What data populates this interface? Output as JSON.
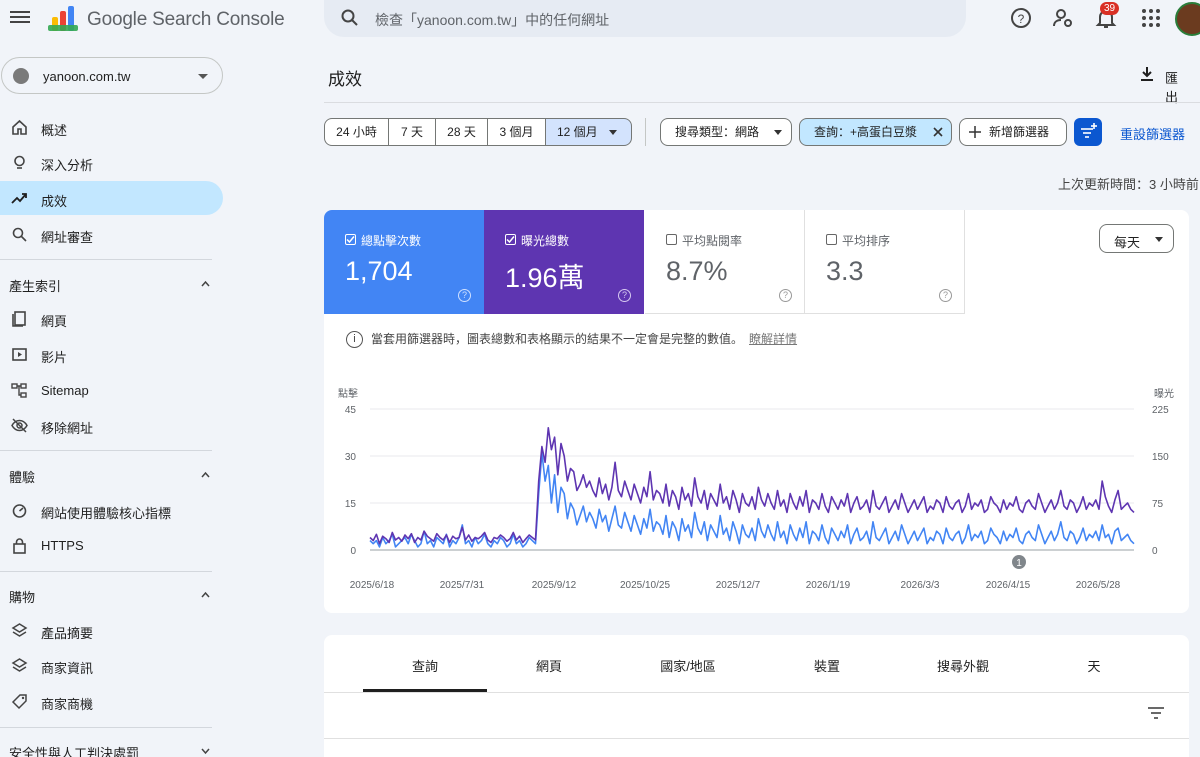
{
  "app": {
    "name": "Google Search Console"
  },
  "search": {
    "placeholder": "檢查「yanoon.com.tw」中的任何網址"
  },
  "notifications": {
    "count": "39"
  },
  "property": {
    "name": "yanoon.com.tw"
  },
  "sidebar": {
    "items": [
      {
        "label": "概述",
        "icon": "home-icon"
      },
      {
        "label": "深入分析",
        "icon": "lightbulb-icon"
      },
      {
        "label": "成效",
        "icon": "trending-up-icon"
      },
      {
        "label": "網址審查",
        "icon": "search-icon"
      }
    ],
    "sections": [
      {
        "title": "產生索引",
        "items": [
          {
            "label": "網頁",
            "icon": "pages-icon"
          },
          {
            "label": "影片",
            "icon": "video-icon"
          },
          {
            "label": "Sitemap",
            "icon": "sitemap-icon"
          },
          {
            "label": "移除網址",
            "icon": "eye-off-icon"
          }
        ]
      },
      {
        "title": "體驗",
        "items": [
          {
            "label": "網站使用體驗核心指標",
            "icon": "gauge-icon"
          },
          {
            "label": "HTTPS",
            "icon": "lock-icon"
          }
        ]
      },
      {
        "title": "購物",
        "items": [
          {
            "label": "產品摘要",
            "icon": "layers-icon"
          },
          {
            "label": "商家資訊",
            "icon": "layers-icon"
          },
          {
            "label": "商家商機",
            "icon": "tag-icon"
          }
        ]
      },
      {
        "title": "安全性與人工判決處罰"
      }
    ]
  },
  "page": {
    "title": "成效",
    "export_label": "匯出",
    "updated": "上次更新時間：3 小時前"
  },
  "filters": {
    "ranges": [
      "24 小時",
      "7 天",
      "28 天",
      "3 個月",
      "12 個月"
    ],
    "search_type": "搜尋類型：網路",
    "query": "查詢：+高蛋白豆漿",
    "add_filter": "新增篩選器",
    "reset": "重設篩選器"
  },
  "metrics": [
    {
      "label": "總點擊次數",
      "value": "1,704",
      "checked": true,
      "color": "#4285f4"
    },
    {
      "label": "曝光總數",
      "value": "1.96萬",
      "checked": true,
      "color": "#5e35b1"
    },
    {
      "label": "平均點閱率",
      "value": "8.7%",
      "checked": false
    },
    {
      "label": "平均排序",
      "value": "3.3",
      "checked": false
    }
  ],
  "granularity": "每天",
  "notice": {
    "text": "當套用篩選器時，圖表總數和表格顯示的結果不一定會是完整的數值。",
    "link": "瞭解詳情"
  },
  "chart_data": {
    "type": "line",
    "left_axis_label": "點擊",
    "right_axis_label": "曝光",
    "left_ticks": [
      "45",
      "30",
      "15",
      "0"
    ],
    "right_ticks": [
      "225",
      "150",
      "75",
      "0"
    ],
    "ylim_left": [
      0,
      45
    ],
    "ylim_right": [
      0,
      225
    ],
    "x_ticks": [
      "2025/6/18",
      "2025/7/31",
      "2025/9/12",
      "2025/10/25",
      "2025/12/7",
      "2026/1/19",
      "2026/3/3",
      "2026/4/15",
      "2026/5/28"
    ],
    "annotation": "1",
    "annotation_at": "2026/4/19",
    "series": [
      {
        "name": "總點擊次數",
        "color": "#4285f4",
        "axis": "left",
        "values": [
          3,
          2,
          3,
          1,
          4,
          2,
          3,
          5,
          1,
          2,
          3,
          4,
          2,
          5,
          3,
          1,
          2,
          6,
          2,
          3,
          1,
          4,
          3,
          2,
          5,
          1,
          3,
          2,
          4,
          8,
          2,
          3,
          1,
          4,
          2,
          3,
          5,
          2,
          1,
          3,
          2,
          4,
          3,
          1,
          2,
          5,
          2,
          3,
          1,
          2,
          4,
          3,
          2,
          18,
          31,
          22,
          27,
          15,
          24,
          12,
          20,
          18,
          10,
          15,
          13,
          8,
          11,
          14,
          9,
          12,
          10,
          7,
          13,
          9,
          11,
          6,
          10,
          14,
          8,
          7,
          12,
          9,
          6,
          11,
          8,
          5,
          10,
          7,
          13,
          6,
          9,
          8,
          5,
          11,
          4,
          9,
          7,
          3,
          10,
          6,
          8,
          4,
          12,
          7,
          5,
          9,
          3,
          8,
          6,
          4,
          11,
          5,
          7,
          3,
          9,
          6,
          2,
          8,
          5,
          4,
          7,
          3,
          10,
          6,
          4,
          8,
          5,
          3,
          9,
          4,
          6,
          2,
          8,
          5,
          3,
          7,
          4,
          9,
          2,
          6,
          5,
          3,
          8,
          4,
          2,
          7,
          5,
          3,
          6,
          4,
          8,
          2,
          5,
          7,
          3,
          4,
          6,
          2,
          9,
          4,
          3,
          5,
          7,
          2,
          4,
          6,
          3,
          8,
          5,
          2,
          4,
          6,
          3,
          5,
          7,
          2,
          4,
          3,
          6,
          5,
          2,
          7,
          4,
          3,
          5,
          6,
          2,
          4,
          8,
          3,
          5,
          4,
          6,
          2,
          3,
          7,
          5,
          4,
          2,
          6,
          3,
          5,
          4,
          7,
          3,
          2,
          5,
          6,
          4,
          3,
          8,
          5,
          2,
          4,
          6,
          3,
          5,
          9,
          4,
          3,
          6,
          5,
          2,
          4,
          7,
          3,
          5,
          4,
          6,
          3,
          8,
          4,
          5,
          2,
          6,
          7,
          3,
          4,
          5,
          3,
          2
        ]
      },
      {
        "name": "曝光總數",
        "color": "#5e35b1",
        "axis": "right",
        "values": [
          20,
          15,
          25,
          10,
          22,
          18,
          12,
          28,
          16,
          20,
          14,
          24,
          18,
          26,
          12,
          20,
          16,
          30,
          22,
          18,
          14,
          26,
          20,
          16,
          24,
          12,
          22,
          18,
          20,
          36,
          16,
          24,
          14,
          20,
          18,
          22,
          28,
          16,
          12,
          20,
          18,
          24,
          20,
          14,
          18,
          28,
          16,
          22,
          12,
          18,
          24,
          20,
          16,
          110,
          165,
          140,
          195,
          160,
          180,
          120,
          170,
          150,
          110,
          130,
          125,
          95,
          105,
          120,
          100,
          110,
          95,
          85,
          115,
          90,
          105,
          80,
          100,
          140,
          95,
          85,
          110,
          95,
          80,
          105,
          90,
          75,
          100,
          85,
          125,
          80,
          95,
          90,
          75,
          105,
          70,
          95,
          85,
          65,
          100,
          80,
          90,
          70,
          115,
          85,
          75,
          95,
          65,
          90,
          80,
          70,
          105,
          75,
          85,
          65,
          95,
          80,
          60,
          90,
          75,
          70,
          85,
          65,
          100,
          80,
          70,
          90,
          75,
          65,
          95,
          70,
          80,
          60,
          90,
          75,
          65,
          85,
          70,
          95,
          60,
          80,
          75,
          65,
          90,
          70,
          60,
          85,
          75,
          65,
          80,
          70,
          90,
          60,
          75,
          85,
          65,
          70,
          80,
          60,
          95,
          70,
          65,
          75,
          85,
          60,
          70,
          80,
          65,
          90,
          75,
          60,
          70,
          80,
          65,
          75,
          85,
          60,
          70,
          65,
          80,
          75,
          60,
          85,
          70,
          65,
          75,
          80,
          60,
          70,
          90,
          65,
          75,
          70,
          80,
          60,
          65,
          85,
          75,
          70,
          60,
          80,
          65,
          75,
          70,
          85,
          65,
          60,
          75,
          80,
          70,
          65,
          90,
          75,
          60,
          70,
          80,
          65,
          75,
          95,
          70,
          65,
          80,
          75,
          60,
          70,
          85,
          65,
          75,
          70,
          80,
          65,
          110,
          85,
          70,
          60,
          80,
          95,
          65,
          70,
          75,
          65,
          60
        ]
      }
    ]
  },
  "table": {
    "tabs": [
      "查詢",
      "網頁",
      "國家/地區",
      "裝置",
      "搜尋外觀",
      "天"
    ]
  }
}
